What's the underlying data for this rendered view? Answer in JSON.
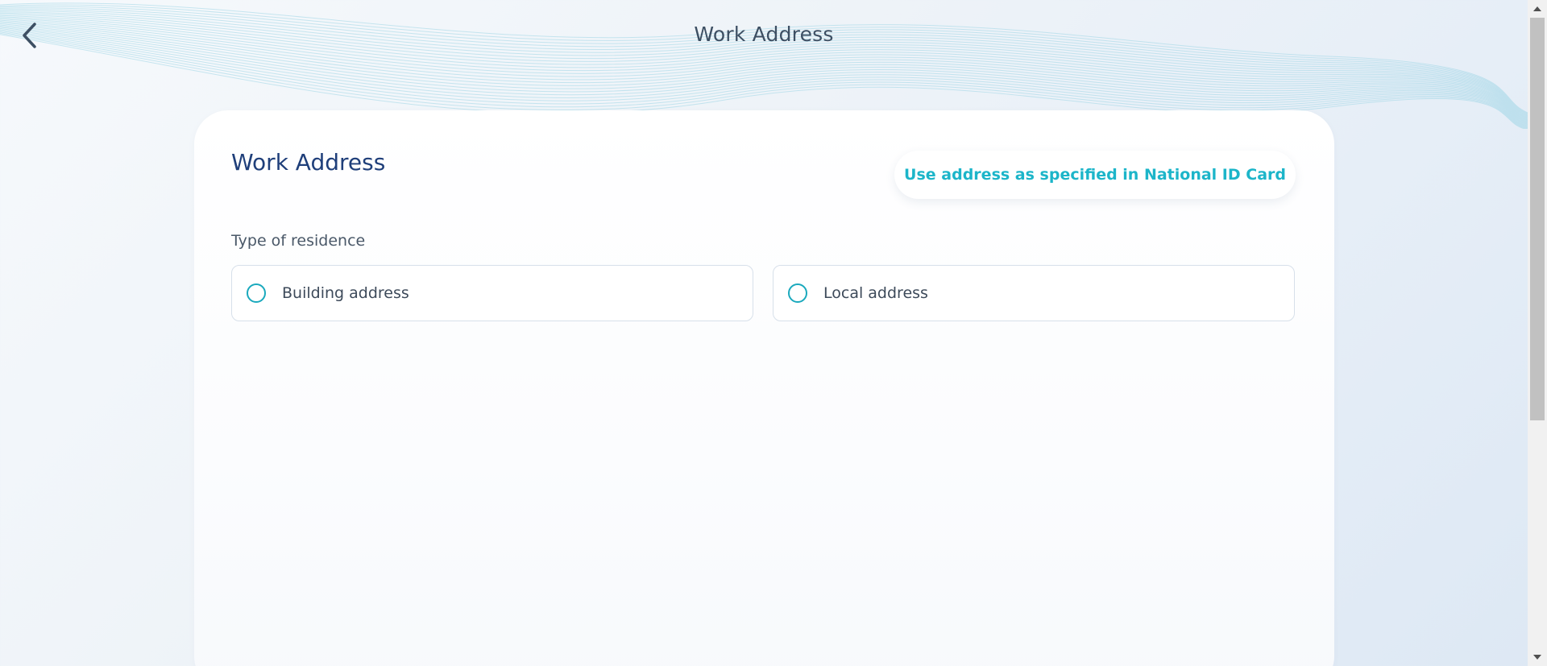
{
  "header": {
    "title": "Work Address",
    "back_icon": "chevron-left-icon"
  },
  "card": {
    "title": "Work Address",
    "id_button_label": "Use address as specified in National ID Card",
    "residence": {
      "label": "Type of residence",
      "options": [
        {
          "label": "Building address",
          "selected": false
        },
        {
          "label": "Local address",
          "selected": false
        }
      ]
    }
  },
  "colors": {
    "accent": "#1cb5c9",
    "title": "#1f3f7a",
    "text": "#3d4f63"
  }
}
